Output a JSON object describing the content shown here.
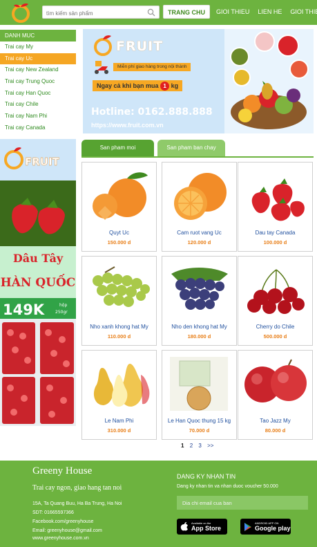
{
  "header": {
    "search_placeholder": "tìm kiếm sản phẩm",
    "nav": [
      {
        "label": "TRANG CHU",
        "active": true
      },
      {
        "label": "GIOI THIEU"
      },
      {
        "label": "LIEN HE"
      },
      {
        "label": "GIOI THIEU"
      }
    ]
  },
  "sidebar": {
    "title": "DANH MUC",
    "items": [
      {
        "label": "Trai cay My"
      },
      {
        "label": "Trai cay Uc",
        "active": true
      },
      {
        "label": "Trai cay New Zealand"
      },
      {
        "label": "Trai cay Trung Quoc"
      },
      {
        "label": "Trai cay Han Quoc"
      },
      {
        "label": "Trai cay Chile"
      },
      {
        "label": "Trai cay Nam Phi"
      },
      {
        "label": "Trai cay Canada"
      }
    ],
    "ad": {
      "brand": "FRUIT",
      "line1": "Dâu Tây",
      "line2": "HÀN QUỐC",
      "price": "149K",
      "unit_top": "hộp",
      "unit_bottom": "250gr"
    }
  },
  "banner": {
    "brand": "FRUIT",
    "shipping": "Miễn phí giao hàng trong nội thành",
    "promo_prefix": "Ngay cả khi bạn mua",
    "promo_qty": "1",
    "promo_suffix": "kg",
    "hotline": "Hotline: 0162.888.888",
    "url": "https://www.fruit.com.vn"
  },
  "tabs": [
    {
      "label": "San pham moi",
      "active": true
    },
    {
      "label": "San pham ban chay"
    }
  ],
  "products": [
    {
      "name": "Quyt Uc",
      "price": "150.000 d",
      "icon": "mandarin-icon"
    },
    {
      "name": "Cam ruot vang Uc",
      "price": "120.000 d",
      "icon": "orange-icon"
    },
    {
      "name": "Dau tay Canada",
      "price": "100.000 d",
      "icon": "strawberry-icon"
    },
    {
      "name": "Nho xanh khong hat My",
      "price": "110.000 d",
      "icon": "green-grape-icon"
    },
    {
      "name": "Nho den khong hat My",
      "price": "180.000 d",
      "icon": "black-grape-icon"
    },
    {
      "name": "Cherry do Chile",
      "price": "500.000 d",
      "icon": "cherry-icon"
    },
    {
      "name": "Le Nam Phi",
      "price": "310.000 d",
      "icon": "pear-icon"
    },
    {
      "name": "Le Han Quoc thung 15 kg",
      "price": "70.000 d",
      "icon": "asian-pear-icon"
    },
    {
      "name": "Tao Jazz My",
      "price": "80.000 d",
      "icon": "apple-icon"
    }
  ],
  "pagination": [
    "1",
    "2",
    "3",
    ">>"
  ],
  "footer": {
    "brand": "Greeny House",
    "slogan": "Trai cay ngon, giao hang tan noi",
    "address": "15A, Ta Quang Buu, Ha Ba Trung, Ha Noi",
    "phone": "SDT: 01665597366",
    "facebook": "Facebook.com/greenyhouse",
    "email": "Email: greenyhouse@gmail.com",
    "website": "www.greenyhouse.com.vn",
    "subscribe_title": "DANG KY NHAN TIN",
    "subscribe_note": "Dang ky nhan tin va nhan duoc voucher 50.000",
    "email_placeholder": "Dia chi email cua ban",
    "appstore_small": "Available on the",
    "appstore_big": "App Store",
    "googleplay_small": "ANDROID APP ON",
    "googleplay_big": "Google play"
  },
  "colors": {
    "brand_green": "#6db33f",
    "accent_orange": "#f5a623",
    "price_orange": "#e87e17",
    "link_blue": "#1f4f9e"
  }
}
